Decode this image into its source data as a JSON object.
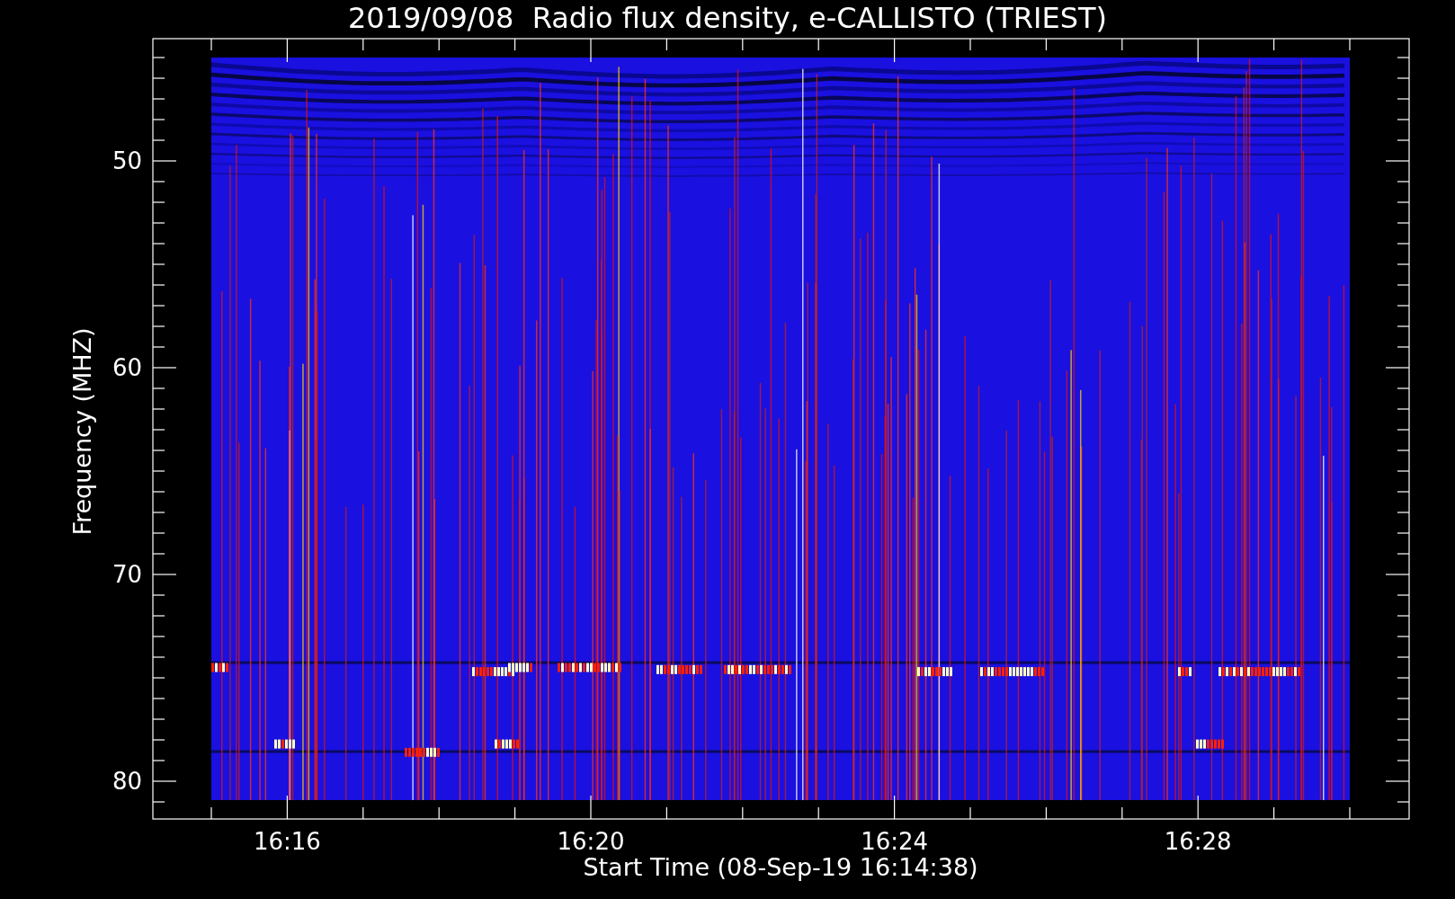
{
  "title": "2019/09/08  Radio flux density, e-CALLISTO (TRIEST)",
  "xlabel": "Start Time (08-Sep-19 16:14:38)",
  "ylabel": "Frequency (MHZ)",
  "xticks": [
    "16:16",
    "16:20",
    "16:24",
    "16:28"
  ],
  "yticks": [
    "50",
    "60",
    "70",
    "80"
  ]
}
